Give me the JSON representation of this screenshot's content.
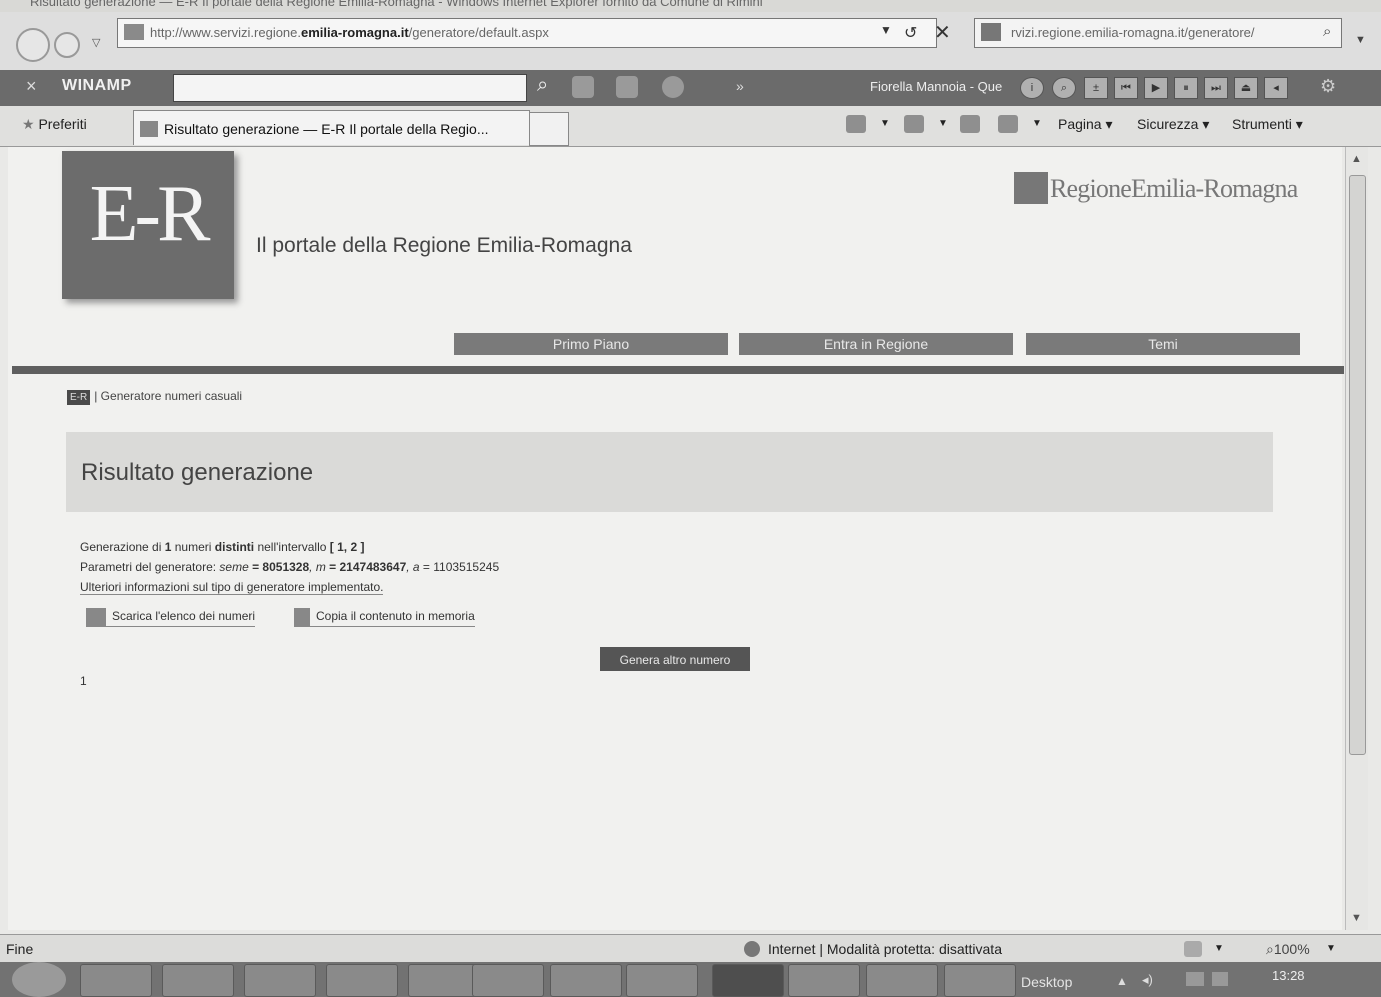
{
  "window": {
    "title": "Risultato generazione — E-R Il portale della Regione Emilia-Romagna - Windows Internet Explorer fornito da Comune di Rimini"
  },
  "address": {
    "url_prefix": "http://www.servizi.regione.",
    "url_domain": "emilia-romagna.it",
    "url_path": "/generatore/default.aspx",
    "search_url": "rvizi.regione.emilia-romagna.it/generatore/"
  },
  "winamp": {
    "brand": "WINAMP",
    "track": "Fiorella Mannoia - Que",
    "search_value": ""
  },
  "favorites": {
    "label": "Preferiti",
    "tab_title": "Risultato generazione — E-R Il portale della Regio...",
    "commands": [
      "Pagina ▾",
      "Sicurezza ▾",
      "Strumenti ▾"
    ]
  },
  "site": {
    "logo": "E-R",
    "tagline": "Il portale della Regione Emilia-Romagna",
    "regione": "RegioneEmilia-Romagna",
    "nav": [
      "Primo Piano",
      "Entra in Regione",
      "Temi"
    ],
    "breadcrumb_logo": "E-R",
    "breadcrumb": "| Generatore numeri casuali"
  },
  "result": {
    "heading": "Risultato generazione",
    "line1_a": "Generazione di ",
    "count": "1",
    "line1_b": " numeri ",
    "distinti": "distinti",
    "line1_c": " nell'intervallo ",
    "interval": "[ 1, 2 ]",
    "line2_a": "Parametri del generatore: ",
    "seme_label": "seme",
    "seme_value": " = 8051328",
    "m_label": ", m",
    "m_value": " = 2147483647",
    "a_label": ", a",
    "a_value": " = 1103515245",
    "more_info": "Ulteriori informazioni sul tipo di generatore implementato.",
    "download": "Scarica l'elenco dei numeri",
    "copy": "Copia il contenuto in memoria",
    "button": "Genera altro numero",
    "value": "1"
  },
  "status": {
    "left": "Fine",
    "zone": "Internet | Modalità protetta: disattivata",
    "zoom": "100%"
  },
  "taskbar": {
    "desktop": "Desktop",
    "clock": "13:28"
  }
}
